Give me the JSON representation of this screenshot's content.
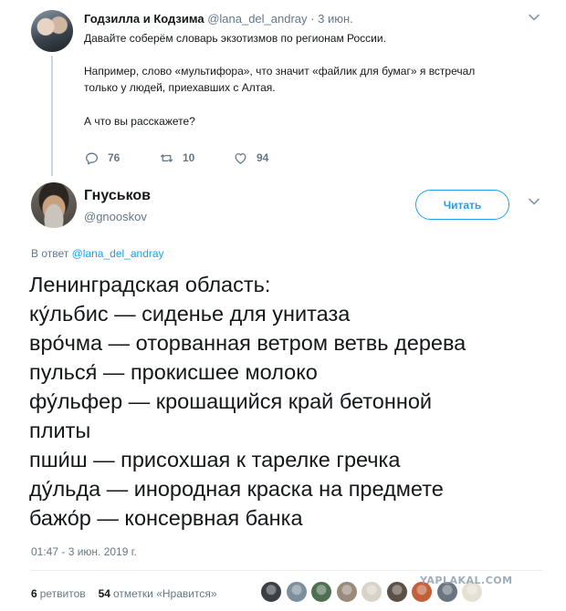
{
  "parent_tweet": {
    "display_name": "Годзилла и Кодзима",
    "handle": "@lana_del_andray",
    "separator": "·",
    "date": "3 июн.",
    "lines": [
      "Давайте соберём словарь экзотизмов по регионам России.",
      "Например, слово «мультифора», что значит «файлик для бумаг» я встречал",
      "только у людей, приехавших с Алтая.",
      "А что вы расскажете?"
    ],
    "replies": "76",
    "retweets": "10",
    "likes": "94"
  },
  "main_tweet": {
    "display_name": "Гнуськов",
    "handle": "@gnooskov",
    "follow_label": "Читать",
    "reply_prefix": "В ответ",
    "reply_to": "@lana_del_andray",
    "lines": [
      "Ленинградская область:",
      "ку́льбис — сиденье для унитаза",
      "вро́чма — оторванная ветром ветвь дерева",
      "пулься́ — прокисшее молоко",
      "фу́льфер — крошащийся край бетонной",
      "плиты",
      "пши́ш — присохшая к тарелке гречка",
      "ду́льда — инородная краска на предмете",
      "бажо́р — консервная банка"
    ],
    "timestamp": "01:47 - 3 июн. 2019 г.",
    "retweet_count": "6",
    "retweet_label": "ретвитов",
    "like_count": "54",
    "like_label": "отметки «Нравится»"
  },
  "likers": [
    {
      "color": "#3b3f45"
    },
    {
      "color": "#7d8f9c"
    },
    {
      "color": "#4f6f52"
    },
    {
      "color": "#9a8a7a"
    },
    {
      "color": "#d8d2c8"
    },
    {
      "color": "#5a5048"
    },
    {
      "color": "#c2603a"
    },
    {
      "color": "#6a7480"
    },
    {
      "color": "#e6e0d4"
    }
  ],
  "watermark": "YAPLAKAL.COM",
  "colors": {
    "accent": "#1da1f2",
    "secondary_text": "#657786",
    "primary_text": "#14171a",
    "thread_line": "#ccd6dd"
  },
  "icons": {
    "caret": "chevron-down-icon",
    "reply": "reply-icon",
    "retweet": "retweet-icon",
    "like": "heart-icon"
  }
}
